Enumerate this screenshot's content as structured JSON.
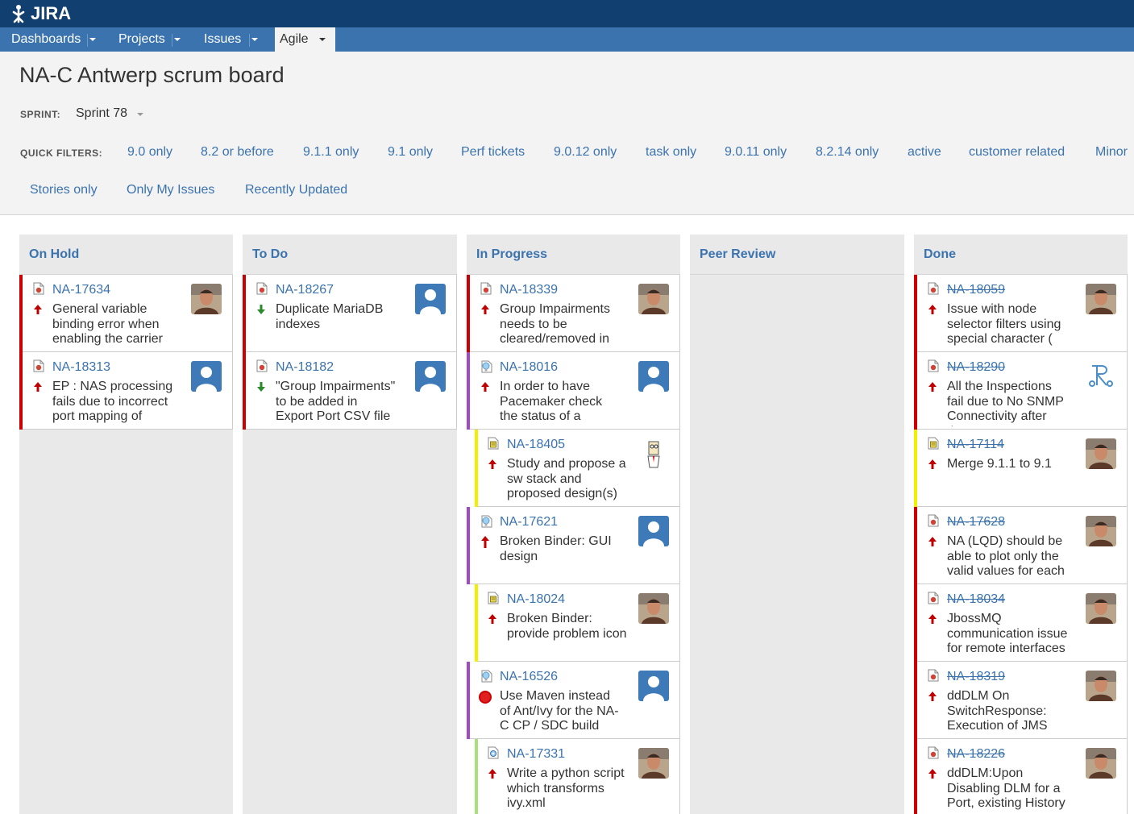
{
  "app": {
    "logo": "JIRA"
  },
  "nav": [
    {
      "label": "Dashboards"
    },
    {
      "label": "Projects"
    },
    {
      "label": "Issues"
    },
    {
      "label": "Agile"
    }
  ],
  "board": {
    "title": "NA-C Antwerp scrum board",
    "sprint_label": "SPRINT:",
    "sprint_value": "Sprint 78",
    "quick_filters_label": "QUICK FILTERS:",
    "quick_filters": [
      "9.0 only",
      "8.2 or before",
      "9.1.1 only",
      "9.1 only",
      "Perf tickets",
      "9.0.12 only",
      "task only",
      "9.0.11 only",
      "8.2.14 only",
      "active",
      "customer related",
      "Minor",
      "Stories only",
      "Only My Issues",
      "Recently Updated"
    ]
  },
  "colors": {
    "header": "#114070",
    "nav": "#3b73af",
    "link": "#3b73af",
    "bar_red": "#cc0000",
    "bar_purple": "#a04ac8",
    "bar_yellow": "#f0f000",
    "bar_green": "#a8e07a"
  },
  "columns": [
    {
      "title": "On Hold",
      "cards": [
        {
          "key": "NA-17634",
          "summary": "General variable binding error when enabling the carrier",
          "type": "bug-icon",
          "priority": "major-priority-icon",
          "avatar": "photo-avatar",
          "bar": "red",
          "sub": false,
          "done": false
        },
        {
          "key": "NA-18313",
          "summary": "EP : NAS processing fails due to incorrect port mapping of",
          "type": "bug-icon",
          "priority": "major-priority-icon",
          "avatar": "default-avatar",
          "bar": "red",
          "sub": false,
          "done": false
        }
      ]
    },
    {
      "title": "To Do",
      "cards": [
        {
          "key": "NA-18267",
          "summary": "Duplicate MariaDB indexes",
          "type": "bug-icon",
          "priority": "minor-priority-icon",
          "avatar": "default-avatar",
          "bar": "red",
          "sub": false,
          "done": false
        },
        {
          "key": "NA-18182",
          "summary": "\"Group Impairments\" to be added in Export Port CSV file",
          "type": "bug-icon",
          "priority": "minor-priority-icon",
          "avatar": "default-avatar",
          "bar": "red",
          "sub": false,
          "done": false
        }
      ]
    },
    {
      "title": "In Progress",
      "cards": [
        {
          "key": "NA-18339",
          "summary": "Group Impairments needs to be cleared/removed in",
          "type": "bug-icon",
          "priority": "major-priority-icon",
          "avatar": "photo-avatar",
          "bar": "red",
          "sub": false,
          "done": false
        },
        {
          "key": "NA-18016",
          "summary": "In order to have Pacemaker check the status of a",
          "type": "improvement-icon",
          "priority": "major-priority-icon",
          "avatar": "default-avatar",
          "bar": "purple",
          "sub": false,
          "done": false
        },
        {
          "key": "NA-18405",
          "summary": "Study and propose a sw stack and proposed design(s)",
          "type": "subtask-icon",
          "priority": "major-priority-icon",
          "avatar": "cartoon-avatar",
          "bar": "yellow",
          "sub": true,
          "done": false
        },
        {
          "key": "NA-17621",
          "summary": "Broken Binder: GUI design",
          "type": "improvement-icon",
          "priority": "critical-priority-icon",
          "avatar": "default-avatar",
          "bar": "purple",
          "sub": false,
          "done": false
        },
        {
          "key": "NA-18024",
          "summary": "Broken Binder: provide problem icon",
          "type": "subtask-icon",
          "priority": "major-priority-icon",
          "avatar": "photo-avatar",
          "bar": "yellow",
          "sub": true,
          "done": false
        },
        {
          "key": "NA-16526",
          "summary": "Use Maven instead of Ant/Ivy for the NA-C CP / SDC build",
          "type": "improvement-icon",
          "priority": "blocker-priority-icon",
          "avatar": "default-avatar",
          "bar": "purple",
          "sub": false,
          "done": false
        },
        {
          "key": "NA-17331",
          "summary": "Write a python script which transforms ivy.xml",
          "type": "task-icon",
          "priority": "major-priority-icon",
          "avatar": "photo-avatar",
          "bar": "green",
          "sub": true,
          "done": false
        }
      ]
    },
    {
      "title": "Peer Review",
      "cards": []
    },
    {
      "title": "Done",
      "cards": [
        {
          "key": "NA-18059",
          "summary": "Issue with node selector filters using special character (",
          "type": "bug-icon",
          "priority": "major-priority-icon",
          "avatar": "photo-avatar",
          "bar": "red",
          "sub": false,
          "done": true
        },
        {
          "key": "NA-18290",
          "summary": "All the Inspections fail due to No SNMP Connectivity after the",
          "type": "bug-icon",
          "priority": "major-priority-icon",
          "avatar": "logo-avatar",
          "bar": "red",
          "sub": false,
          "done": true
        },
        {
          "key": "NA-17114",
          "summary": "Merge 9.1.1 to 9.1",
          "type": "subtask-icon",
          "priority": "major-priority-icon",
          "avatar": "photo-avatar",
          "bar": "yellow",
          "sub": false,
          "done": true
        },
        {
          "key": "NA-17628",
          "summary": "NA (LQD) should be able to plot only the valid values for each",
          "type": "bug-icon",
          "priority": "major-priority-icon",
          "avatar": "photo-avatar",
          "bar": "red",
          "sub": false,
          "done": true
        },
        {
          "key": "NA-18034",
          "summary": "JbossMQ communication issue for remote interfaces",
          "type": "bug-icon",
          "priority": "major-priority-icon",
          "avatar": "photo-avatar",
          "bar": "red",
          "sub": false,
          "done": true
        },
        {
          "key": "NA-18319",
          "summary": "ddDLM On SwitchResponse: Execution of JMS",
          "type": "bug-icon",
          "priority": "major-priority-icon",
          "avatar": "photo-avatar",
          "bar": "red",
          "sub": false,
          "done": true
        },
        {
          "key": "NA-18226",
          "summary": "ddDLM:Upon Disabling DLM for a Port, existing History",
          "type": "bug-icon",
          "priority": "major-priority-icon",
          "avatar": "photo-avatar",
          "bar": "red",
          "sub": false,
          "done": true
        }
      ]
    }
  ]
}
